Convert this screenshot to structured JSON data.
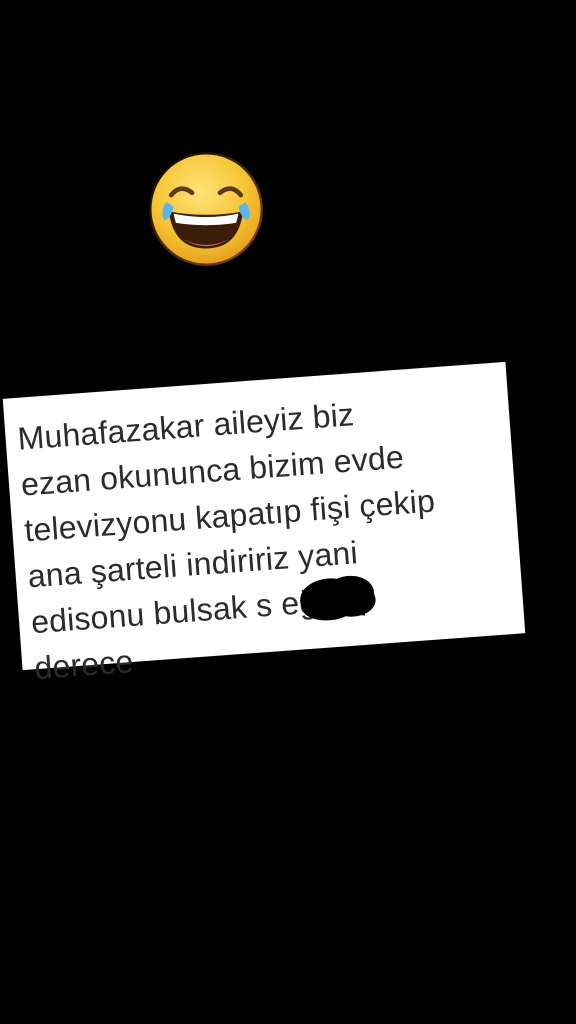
{
  "emoji": {
    "icon": "face-with-tears-of-joy-icon"
  },
  "note": {
    "lines": [
      "Muhafazakar aileyiz biz",
      "ezan okununca bizim evde",
      "televizyonu kapatıp fişi çekip",
      "ana şarteli indiririz yani",
      "edisonu bulsak s         eğiz o",
      "derece"
    ]
  },
  "colors": {
    "background": "#000000",
    "note_background": "#ffffff",
    "text": "#2b2b2b",
    "emoji_face": "#f4c431",
    "tear": "#5ab4f0"
  }
}
